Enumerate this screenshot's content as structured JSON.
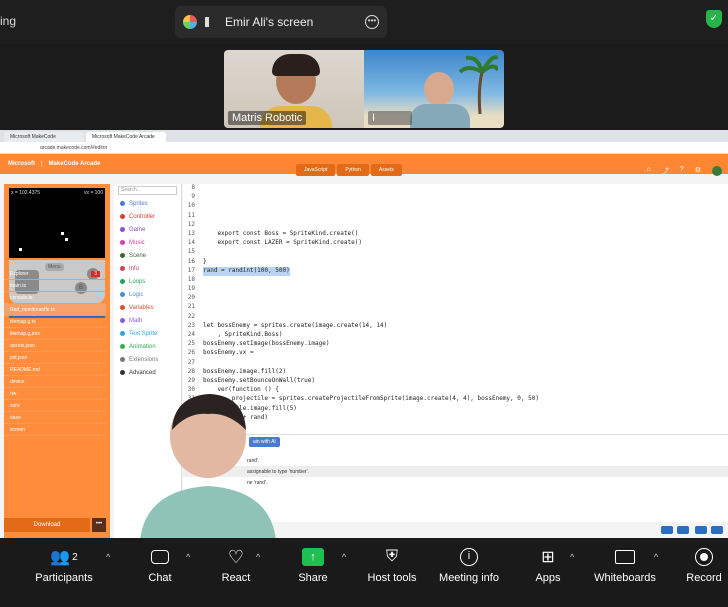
{
  "topbar": {
    "left_text": "ing",
    "share_title": "Emir Ali's screen"
  },
  "videos": [
    {
      "name": "Matris Robotic"
    },
    {
      "name": "I"
    }
  ],
  "browser": {
    "tabs": [
      "Microsoft MakeCode",
      "Microsoft MakeCode Arcade"
    ],
    "url": "arcade.makecode.com/#editor"
  },
  "makecode": {
    "brand": "Microsoft",
    "product": "MakeCode Arcade",
    "mode_tabs": [
      "JavaScript",
      "Python",
      "Assets"
    ],
    "sim_readout_left": "x = 102.4375",
    "sim_readout_right": "vx = 100",
    "menu_label": "Menu",
    "search_placeholder": "Search...",
    "toolbox": [
      {
        "label": "Sprites",
        "color": "#4b7bcf"
      },
      {
        "label": "Controller",
        "color": "#d7402b"
      },
      {
        "label": "Game",
        "color": "#8a4fd3"
      },
      {
        "label": "Music",
        "color": "#d93ea6"
      },
      {
        "label": "Scene",
        "color": "#3b6b2f"
      },
      {
        "label": "Info",
        "color": "#cf3f55"
      },
      {
        "label": "Loops",
        "color": "#20a25a"
      },
      {
        "label": "Logic",
        "color": "#4a8fd6"
      },
      {
        "label": "Variables",
        "color": "#d9502c"
      },
      {
        "label": "Math",
        "color": "#8d5bd8"
      },
      {
        "label": "Text Sprite",
        "color": "#2aa9d8"
      },
      {
        "label": "Animation",
        "color": "#2fae4f"
      },
      {
        "label": "Extensions",
        "color": "#777777"
      },
      {
        "label": "Advanced",
        "color": "#333333"
      }
    ],
    "explorer": [
      "Explorer",
      "main.ts",
      "console.ts",
      "Rad_monitoranfle.ts",
      "tilemap.g.ts",
      "tilemap.g.jres",
      "assets.json",
      "pxt.json",
      "README.md",
      "device",
      "hw",
      "core",
      "base",
      "screen"
    ],
    "download_label": "Download",
    "download_more": "•••",
    "code_lines": [
      {
        "n": "8",
        "t": ""
      },
      {
        "n": "9",
        "t": ""
      },
      {
        "n": "10",
        "t": ""
      },
      {
        "n": "11",
        "t": ""
      },
      {
        "n": "12",
        "t": ""
      },
      {
        "n": "13",
        "t": "    export const Boss = SpriteKind.create()"
      },
      {
        "n": "14",
        "t": "    export const LAZER = SpriteKind.create()"
      },
      {
        "n": "15",
        "t": ""
      },
      {
        "n": "16",
        "t": "}"
      },
      {
        "n": "17",
        "t": "rand = randint(100, 500)"
      },
      {
        "n": "18",
        "t": ""
      },
      {
        "n": "19",
        "t": ""
      },
      {
        "n": "20",
        "t": ""
      },
      {
        "n": "21",
        "t": ""
      },
      {
        "n": "22",
        "t": ""
      },
      {
        "n": "23",
        "t": "let bossEnemy = sprites.create(image.create(14, 14)"
      },
      {
        "n": "24",
        "t": "    , SpriteKind.Boss)"
      },
      {
        "n": "25",
        "t": "bossEnemy.setImage(bossEnemy.image)"
      },
      {
        "n": "26",
        "t": "bossEnemy.vx ="
      },
      {
        "n": "27",
        "t": ""
      },
      {
        "n": "28",
        "t": "bossEnemy.image.fill(2)"
      },
      {
        "n": "29",
        "t": "bossEnemy.setBounceOnWall(true)"
      },
      {
        "n": "30",
        "t": "    ver(function () {"
      },
      {
        "n": "31",
        "t": "        projectile = sprites.createProjectileFromSprite(image.create(4, 4), bossEnemy, 0, 50)"
      },
      {
        "n": "32",
        "t": "        tile.image.fill(5)"
      },
      {
        "n": "33",
        "t": "        00 + rand)"
      }
    ],
    "console_lines": [
      "ain with AI",
      "rand'.",
      "assignable to type 'number'.",
      "ne 'rand'."
    ]
  },
  "controls": {
    "participants_count": "2",
    "items": [
      "Participants",
      "Chat",
      "React",
      "Share",
      "Host tools",
      "Meeting info",
      "Apps",
      "Whiteboards",
      "Record"
    ]
  }
}
